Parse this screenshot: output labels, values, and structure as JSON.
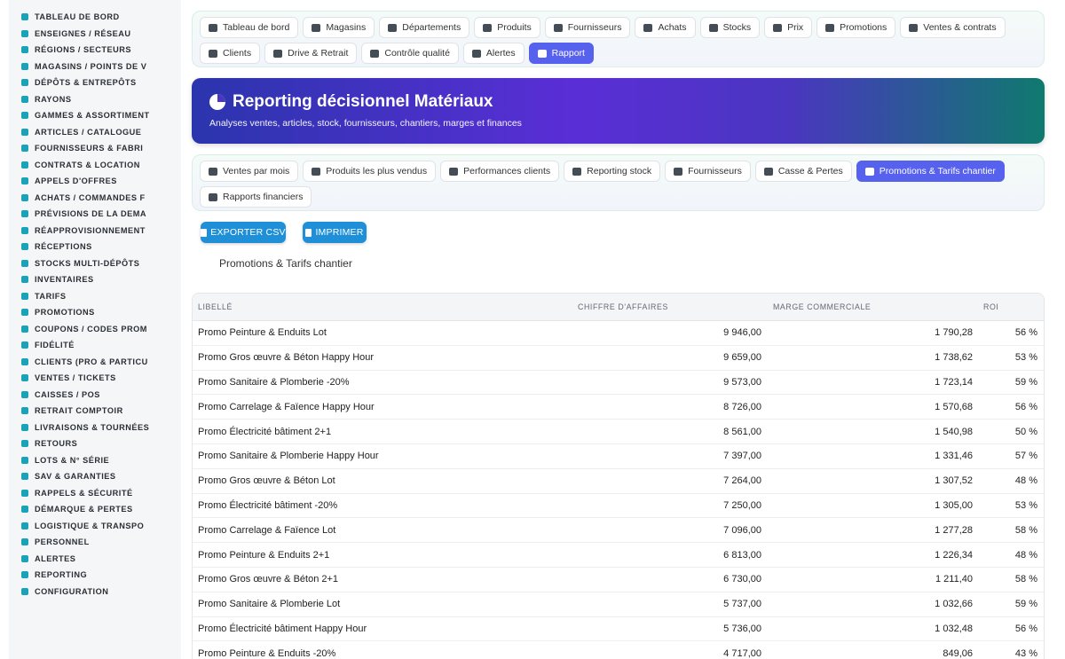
{
  "sidebar": {
    "items": [
      {
        "label": "TABLEAU DE BORD",
        "icon": "dashboard-icon"
      },
      {
        "label": "ENSEIGNES / RÉSEAU",
        "icon": "flag-icon"
      },
      {
        "label": "RÉGIONS / SECTEURS",
        "icon": "map-icon"
      },
      {
        "label": "MAGASINS / POINTS DE V",
        "icon": "store-icon"
      },
      {
        "label": "DÉPÔTS & ENTREPÔTS",
        "icon": "warehouse-icon"
      },
      {
        "label": "RAYONS",
        "icon": "shelf-icon"
      },
      {
        "label": "GAMMES & ASSORTIMENT",
        "icon": "layers-icon"
      },
      {
        "label": "ARTICLES / CATALOGUE",
        "icon": "book-icon"
      },
      {
        "label": "FOURNISSEURS & FABRI",
        "icon": "factory-icon"
      },
      {
        "label": "CONTRATS & LOCATION",
        "icon": "contract-icon"
      },
      {
        "label": "APPELS D'OFFRES",
        "icon": "gavel-icon"
      },
      {
        "label": "ACHATS / COMMANDES F",
        "icon": "cart-icon"
      },
      {
        "label": "PRÉVISIONS DE LA DEMA",
        "icon": "chart-line-icon"
      },
      {
        "label": "RÉAPPROVISIONNEMENT",
        "icon": "refresh-icon"
      },
      {
        "label": "RÉCEPTIONS",
        "icon": "inbox-icon"
      },
      {
        "label": "STOCKS MULTI-DÉPÔTS",
        "icon": "boxes-icon"
      },
      {
        "label": "INVENTAIRES",
        "icon": "clipboard-icon"
      },
      {
        "label": "TARIFS",
        "icon": "tag-icon"
      },
      {
        "label": "PROMOTIONS",
        "icon": "percent-icon"
      },
      {
        "label": "COUPONS / CODES PROM",
        "icon": "ticket-icon"
      },
      {
        "label": "FIDÉLITÉ",
        "icon": "star-icon"
      },
      {
        "label": "CLIENTS (PRO & PARTICU",
        "icon": "user-icon"
      },
      {
        "label": "VENTES / TICKETS",
        "icon": "receipt-icon"
      },
      {
        "label": "CAISSES / POS",
        "icon": "cash-register-icon"
      },
      {
        "label": "RETRAIT COMPTOIR",
        "icon": "car-icon"
      },
      {
        "label": "LIVRAISONS & TOURNÉES",
        "icon": "truck-icon"
      },
      {
        "label": "RETOURS",
        "icon": "undo-icon"
      },
      {
        "label": "LOTS & N° SÉRIE",
        "icon": "barcode-icon"
      },
      {
        "label": "SAV & GARANTIES",
        "icon": "tools-icon"
      },
      {
        "label": "RAPPELS & SÉCURITÉ",
        "icon": "warning-icon"
      },
      {
        "label": "DÉMARQUE & PERTES",
        "icon": "trash-icon"
      },
      {
        "label": "LOGISTIQUE & TRANSPO",
        "icon": "pallet-icon"
      },
      {
        "label": "PERSONNEL",
        "icon": "users-icon"
      },
      {
        "label": "ALERTES",
        "icon": "bell-icon"
      },
      {
        "label": "REPORTING",
        "icon": "pie-chart-icon"
      },
      {
        "label": "CONFIGURATION",
        "icon": "gear-icon"
      }
    ]
  },
  "topnav": {
    "tabs": [
      {
        "label": "Tableau de bord",
        "icon": "dashboard-icon"
      },
      {
        "label": "Magasins",
        "icon": "store-icon"
      },
      {
        "label": "Départements",
        "icon": "building-icon"
      },
      {
        "label": "Produits",
        "icon": "box-icon"
      },
      {
        "label": "Fournisseurs",
        "icon": "truck-loading-icon"
      },
      {
        "label": "Achats",
        "icon": "cart-icon"
      },
      {
        "label": "Stocks",
        "icon": "boxes-icon"
      },
      {
        "label": "Prix",
        "icon": "tags-icon"
      },
      {
        "label": "Promotions",
        "icon": "percent-icon"
      },
      {
        "label": "Ventes & contrats",
        "icon": "receipt-icon"
      },
      {
        "label": "Clients",
        "icon": "user-icon"
      },
      {
        "label": "Drive & Retrait",
        "icon": "car-icon"
      },
      {
        "label": "Contrôle qualité",
        "icon": "check-icon"
      },
      {
        "label": "Alertes",
        "icon": "bell-icon"
      },
      {
        "label": "Rapport",
        "icon": "pie-chart-icon",
        "active": true
      }
    ]
  },
  "banner": {
    "title": "Reporting décisionnel Matériaux",
    "subtitle": "Analyses ventes, articles, stock, fournisseurs, chantiers, marges et finances",
    "gradient_start": "#2b35ad",
    "gradient_end": "#0f7a6e"
  },
  "subnav": {
    "tabs": [
      {
        "label": "Ventes par mois",
        "icon": "chart-line-icon"
      },
      {
        "label": "Produits les plus vendus",
        "icon": "box-icon"
      },
      {
        "label": "Performances clients",
        "icon": "users-icon"
      },
      {
        "label": "Reporting stock",
        "icon": "warehouse-icon"
      },
      {
        "label": "Fournisseurs",
        "icon": "handshake-icon"
      },
      {
        "label": "Casse & Pertes",
        "icon": "trash-icon"
      },
      {
        "label": "Promotions & Tarifs chantier",
        "icon": "percent-icon",
        "active": true
      },
      {
        "label": "Rapports financiers",
        "icon": "coins-icon"
      }
    ]
  },
  "actions": {
    "export_label": "EXPORTER CSV",
    "print_label": "IMPRIMER"
  },
  "section_title": "Promotions & Tarifs chantier",
  "table": {
    "headers": [
      "LIBELLÉ",
      "CHIFFRE D'AFFAIRES",
      "MARGE COMMERCIALE",
      "ROI"
    ],
    "rows": [
      [
        "Promo Peinture & Enduits Lot",
        "9 946,00",
        "1 790,28",
        "56 %"
      ],
      [
        "Promo Gros œuvre & Béton Happy Hour",
        "9 659,00",
        "1 738,62",
        "53 %"
      ],
      [
        "Promo Sanitaire & Plomberie -20%",
        "9 573,00",
        "1 723,14",
        "59 %"
      ],
      [
        "Promo Carrelage & Faïence Happy Hour",
        "8 726,00",
        "1 570,68",
        "56 %"
      ],
      [
        "Promo Électricité bâtiment 2+1",
        "8 561,00",
        "1 540,98",
        "50 %"
      ],
      [
        "Promo Sanitaire & Plomberie Happy Hour",
        "7 397,00",
        "1 331,46",
        "57 %"
      ],
      [
        "Promo Gros œuvre & Béton Lot",
        "7 264,00",
        "1 307,52",
        "48 %"
      ],
      [
        "Promo Électricité bâtiment -20%",
        "7 250,00",
        "1 305,00",
        "53 %"
      ],
      [
        "Promo Carrelage & Faïence Lot",
        "7 096,00",
        "1 277,28",
        "58 %"
      ],
      [
        "Promo Peinture & Enduits 2+1",
        "6 813,00",
        "1 226,34",
        "48 %"
      ],
      [
        "Promo Gros œuvre & Béton 2+1",
        "6 730,00",
        "1 211,40",
        "58 %"
      ],
      [
        "Promo Sanitaire & Plomberie Lot",
        "5 737,00",
        "1 032,66",
        "59 %"
      ],
      [
        "Promo Électricité bâtiment Happy Hour",
        "5 736,00",
        "1 032,48",
        "56 %"
      ],
      [
        "Promo Peinture & Enduits -20%",
        "4 717,00",
        "849,06",
        "43 %"
      ]
    ]
  },
  "colors": {
    "accent": "#5661ee",
    "button": "#1f8fd8",
    "sidebar_icon": "#1aa3b8"
  }
}
